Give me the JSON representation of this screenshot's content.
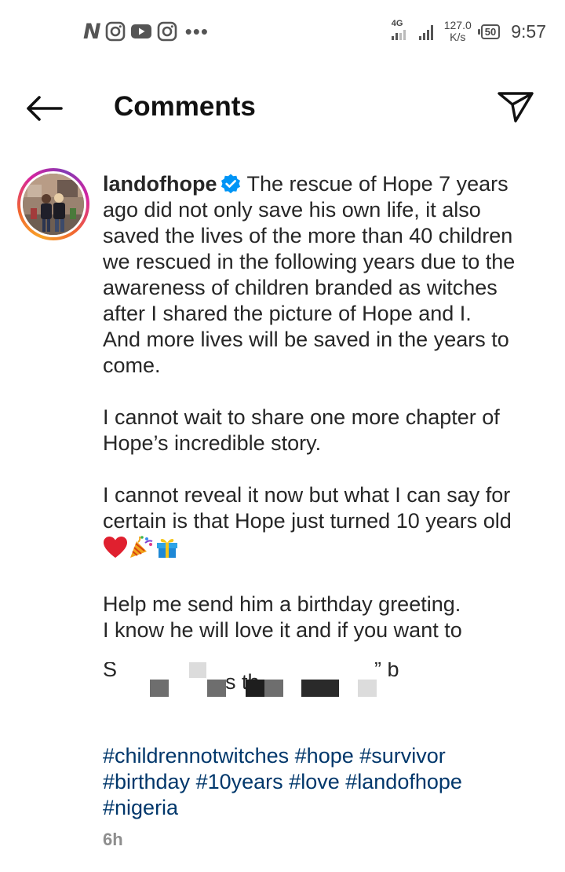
{
  "status_bar": {
    "network_type": "4G",
    "speed_value": "127.0",
    "speed_unit": "K/s",
    "battery": "50",
    "time": "9:57"
  },
  "header": {
    "title": "Comments"
  },
  "post": {
    "username": "landofhope",
    "verified": true,
    "paragraphs": [
      "The rescue of Hope 7 years ago did not only save his own life, it also saved the lives of the more than 40 children we rescued in the following years due to the awareness of children branded as witches after I shared the picture of Hope and I.",
      "And more lives will be saved in the years to come.",
      "I cannot wait to share one more chapter of Hope’s incredible story.",
      "I cannot reveal it now but what I can say for certain is that Hope just turned 10 years old",
      "Help me send him a birthday greeting.",
      "I know he will love it and if you want to"
    ],
    "truncated_fragment_1": "S",
    "truncated_fragment_2": "s th",
    "truncated_fragment_3": "” b",
    "hashtags": [
      "#childrennotwitches",
      "#hope",
      "#survivor",
      "#birthday",
      "#10years",
      "#love",
      "#landofhope",
      "#nigeria"
    ],
    "timestamp": "6h"
  },
  "icons": {
    "back": "arrow-left-icon",
    "share": "paper-plane-icon",
    "verified": "verified-badge-icon"
  },
  "colors": {
    "hashtag": "#00376b",
    "verified": "#0095f6",
    "text": "#262626",
    "timestamp": "#8e8e8e"
  }
}
